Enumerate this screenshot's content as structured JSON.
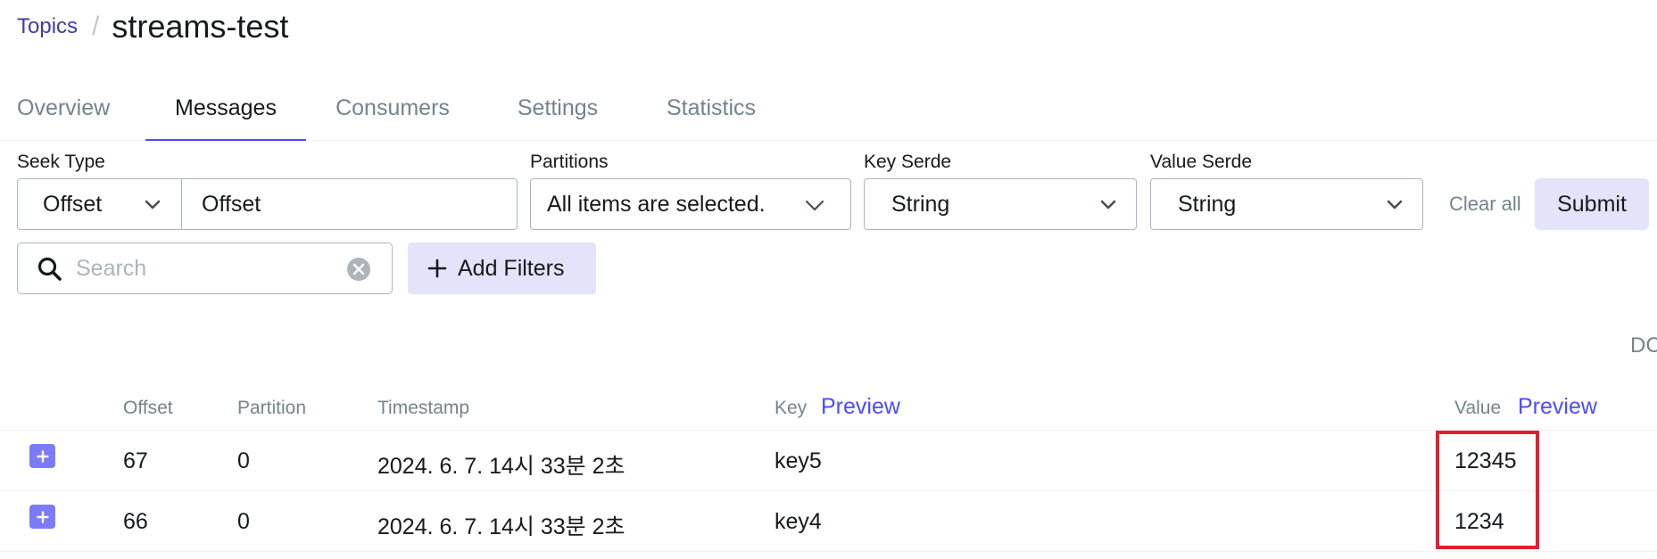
{
  "breadcrumb": {
    "link": "Topics",
    "separator": "/",
    "title": "streams-test"
  },
  "tabs": [
    {
      "label": "Overview",
      "active": false
    },
    {
      "label": "Messages",
      "active": true
    },
    {
      "label": "Consumers",
      "active": false
    },
    {
      "label": "Settings",
      "active": false
    },
    {
      "label": "Statistics",
      "active": false
    }
  ],
  "filters": {
    "seek_type": {
      "label": "Seek Type",
      "type_value": "Offset",
      "offset_value": "Offset"
    },
    "partitions": {
      "label": "Partitions",
      "value": "All items are selected."
    },
    "key_serde": {
      "label": "Key Serde",
      "value": "String"
    },
    "value_serde": {
      "label": "Value Serde",
      "value": "String"
    },
    "clear_all": "Clear all",
    "submit": "Submit"
  },
  "search": {
    "placeholder": "Search"
  },
  "add_filters": "Add Filters",
  "sort_indicator": "DC",
  "table": {
    "columns": {
      "offset": "Offset",
      "partition": "Partition",
      "timestamp": "Timestamp",
      "key": "Key",
      "value": "Value"
    },
    "preview_label": "Preview",
    "rows": [
      {
        "offset": "67",
        "partition": "0",
        "timestamp": "2024. 6. 7. 14시 33분 2초",
        "key": "key5",
        "value": "12345"
      },
      {
        "offset": "66",
        "partition": "0",
        "timestamp": "2024. 6. 7. 14시 33분 2초",
        "key": "key4",
        "value": "1234"
      }
    ]
  },
  "colors": {
    "accent": "#4c4cff",
    "link": "#3e3ea8",
    "button_bg": "#e3e3fa",
    "expand_button": "#7b7bf7",
    "highlight": "#e02030"
  }
}
